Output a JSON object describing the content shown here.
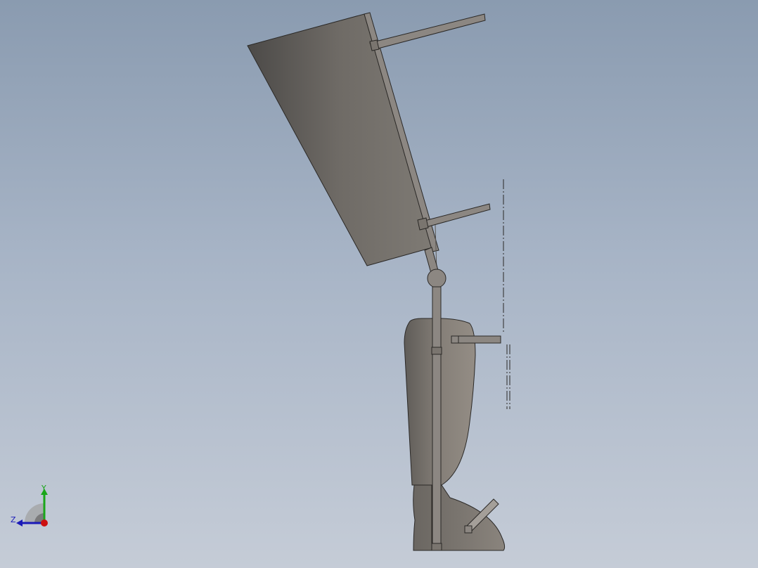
{
  "viewport": {
    "bg_top": "#8a9bb0",
    "bg_bottom": "#c5ccd7"
  },
  "model": {
    "body_color": "#7a756f",
    "body_dark": "#4c4a48",
    "edge_color": "#2a2826",
    "rod_color": "#8c8782"
  },
  "triad": {
    "y_label": "Y",
    "z_label": "Z",
    "y_color": "#1aa61a",
    "z_color": "#1a1ab8",
    "x_color": "#cc1010"
  }
}
